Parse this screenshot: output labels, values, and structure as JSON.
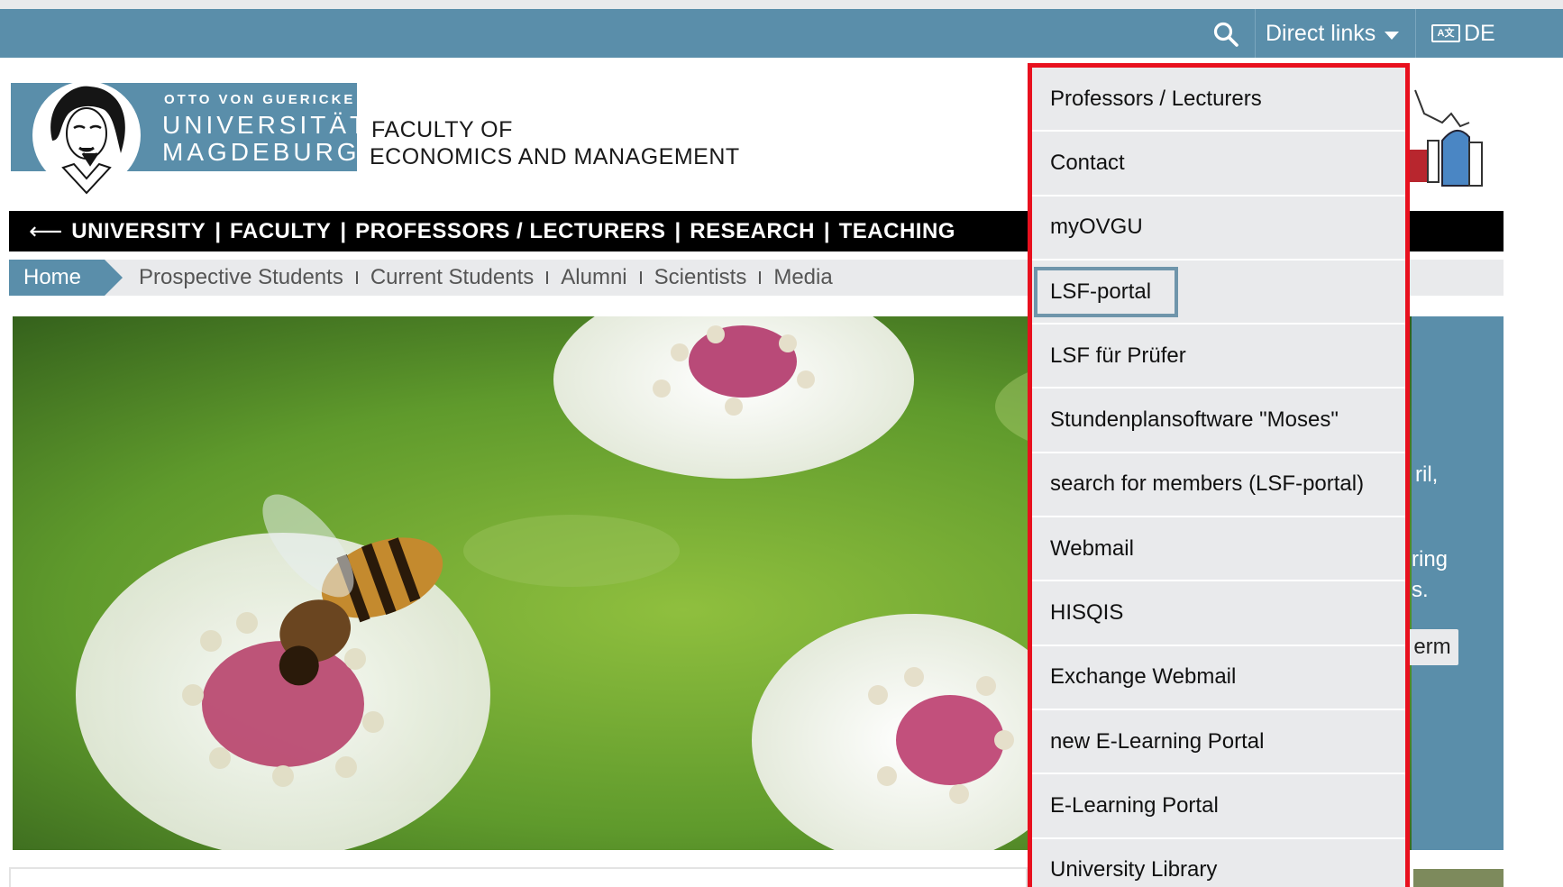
{
  "topbar": {
    "direct_links_label": "Direct links",
    "language_label": "DE",
    "language_icon": "A文"
  },
  "header": {
    "logo_line1": "OTTO VON GUERICKE",
    "logo_line2": "UNIVERSITÄT",
    "logo_line3": "MAGDEBURG",
    "faculty_line1": "FACULTY OF",
    "faculty_line2": "ECONOMICS AND MANAGEMENT"
  },
  "mainnav": {
    "back_arrow": "⟵",
    "items": [
      "UNIVERSITY",
      "FACULTY",
      "PROFESSORS / LECTURERS",
      "RESEARCH",
      "TEACHING"
    ],
    "separator": "|"
  },
  "audience_bar": {
    "home": "Home",
    "items": [
      "Prospective Students",
      "Current Students",
      "Alumni",
      "Scientists",
      "Media"
    ]
  },
  "side_panel": {
    "fragments": [
      "ril,",
      "ring",
      "s."
    ],
    "button_fragment": "erm"
  },
  "dropdown": {
    "items": [
      "Professors / Lecturers",
      "Contact",
      "myOVGU",
      "LSF-portal",
      "LSF für Prüfer",
      "Stundenplansoftware \"Moses\"",
      "search for members (LSF-portal)",
      "Webmail",
      "HISQIS",
      "Exchange Webmail",
      "new E-Learning Portal",
      "E-Learning Portal",
      "University Library"
    ],
    "focused_index": 3,
    "highlight_color": "#e8101e"
  },
  "colors": {
    "brand_blue": "#5a8eaa",
    "nav_black": "#000000",
    "bar_grey": "#e9eaec"
  }
}
